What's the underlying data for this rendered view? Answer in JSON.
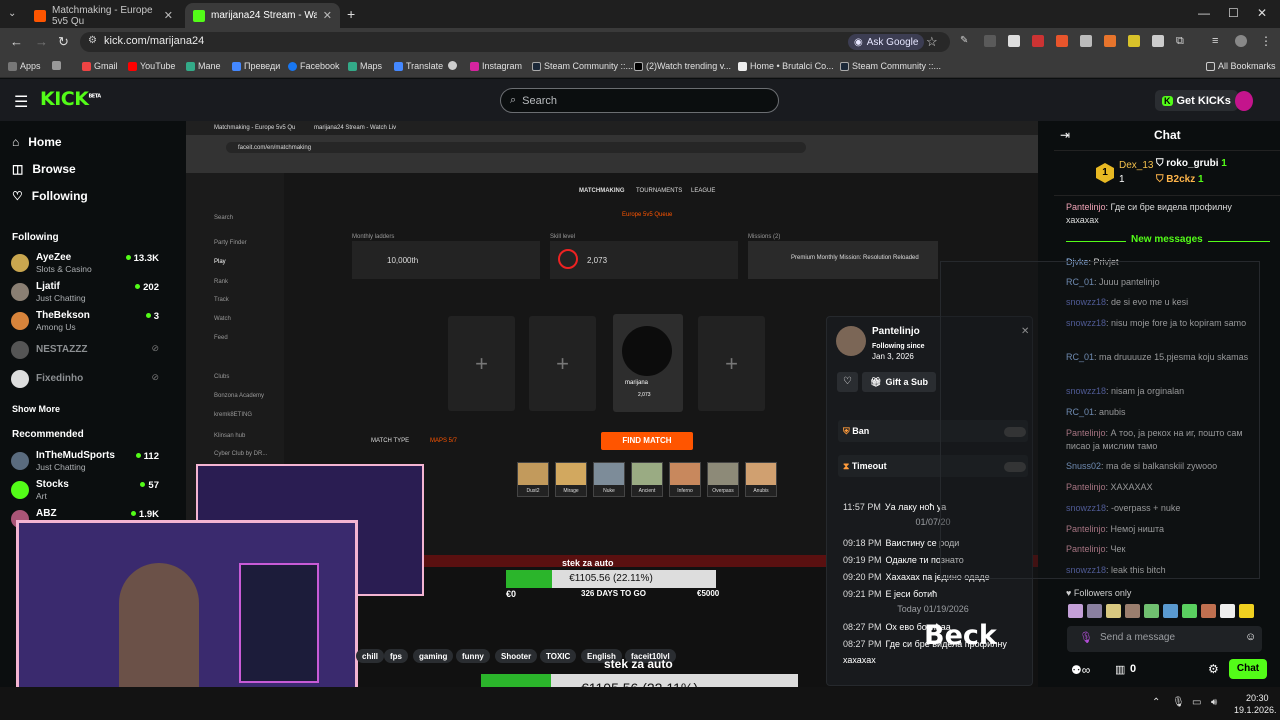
{
  "browser": {
    "tabs": [
      {
        "title": "Matchmaking - Europe 5v5 Qu",
        "active": false
      },
      {
        "title": "marijana24 Stream - Watch Liv",
        "active": true
      }
    ],
    "url": "kick.com/marijana24",
    "ask_google": "Ask Google",
    "bookmarks": [
      "Apps",
      "Gmail",
      "YouTube",
      "Mane",
      "Преведи",
      "Facebook",
      "Maps",
      "Translate",
      "Instagram",
      "Steam Community ::...",
      "(2)Watch trending v...",
      "Home • Brutalci Co...",
      "Steam Community ::..."
    ],
    "all_bookmarks": "All Bookmarks"
  },
  "kick": {
    "logo": "KICK",
    "logo_sup": "BETA",
    "search_placeholder": "Search",
    "get_kicks": "Get KICKs",
    "nav": [
      "Home",
      "Browse",
      "Following"
    ],
    "following_title": "Following",
    "following": [
      {
        "name": "AyeZee",
        "category": "Slots & Casino",
        "viewers": "13.3K",
        "color": "#c9a64f"
      },
      {
        "name": "Ljatif",
        "category": "Just Chatting",
        "viewers": "202",
        "color": "#8a7f73"
      },
      {
        "name": "TheBekson",
        "category": "Among Us",
        "viewers": "3",
        "color": "#d8843b"
      },
      {
        "name": "NESTAZZZ",
        "category": "",
        "viewers": "",
        "color": "#555"
      },
      {
        "name": "Fixedinho",
        "category": "",
        "viewers": "",
        "color": "#ddd"
      }
    ],
    "show_more": "Show More",
    "recommended_title": "Recommended",
    "recommended": [
      {
        "name": "InTheMudSports",
        "category": "Just Chatting",
        "viewers": "112",
        "color": "#5a6b7e"
      },
      {
        "name": "Stocks",
        "category": "Art",
        "viewers": "57",
        "color": "#53fc18"
      },
      {
        "name": "ABZ",
        "category": "",
        "viewers": "1.9K",
        "color": "#a57"
      }
    ]
  },
  "overlay": {
    "stek_label": "stek za auto",
    "goal_amount": "€1105.56 (22.11%)",
    "goal_progress": 0.2211,
    "start": "€0",
    "days": "326 DAYS TO GO",
    "end": "€5000",
    "watermark": "Beck"
  },
  "inner": {
    "tabs": [
      "Matchmaking - Europe 5v5 Qu",
      "marijana24 Stream - Watch Liv"
    ],
    "url": "faceit.com/en/matchmaking",
    "nav_tabs": [
      "MATCHMAKING",
      "TOURNAMENTS",
      "LEAGUE"
    ],
    "queue_label": "Europe 5v5 Queue",
    "menu": [
      "Search",
      "Party Finder",
      "Play",
      "Rank",
      "Track",
      "Watch",
      "Feed",
      "Clubs",
      "Bonzona Academy",
      "kremk8ETING",
      "Klinsan hub",
      "Cyber Club by DR..."
    ],
    "cards": [
      {
        "label": "Monthly ladders",
        "value": "10,000th"
      },
      {
        "label": "Skill level",
        "value": "2,073"
      },
      {
        "label": "Missions (2)",
        "value": "Premium Monthly Mission: Resolution Reloaded"
      }
    ],
    "player_name": "marijana",
    "player_elo": "2,073",
    "match_type": "MATCH TYPE",
    "maps": "MAPS 5/7",
    "find_match": "FIND MATCH",
    "map_names": [
      "Dust2",
      "Mirage",
      "Nuke",
      "Ancient",
      "Inferno",
      "Overpass",
      "Anubis"
    ]
  },
  "popup": {
    "name": "Pantelinjo",
    "following_since_label": "Following since",
    "following_since": "Jan 3, 2026",
    "gift_sub": "Gift a Sub",
    "ban": "Ban",
    "timeout": "Timeout",
    "history": [
      {
        "t": "11:57 PM",
        "m": "Уа лаку ноћ уа"
      },
      {
        "sep": "01/07/20"
      },
      {
        "t": "09:18 PM",
        "m": "Ваистину се роди"
      },
      {
        "t": "09:19 PM",
        "m": "Одакле ти познато"
      },
      {
        "t": "09:20 PM",
        "m": "Хахахах па једино одаде"
      },
      {
        "t": "09:21 PM",
        "m": "Е јеси ботић"
      },
      {
        "sep": "Today 01/19/2026"
      },
      {
        "t": "08:27 PM",
        "m": "Ох ево ботићаа"
      },
      {
        "t": "08:27 PM",
        "m": "Где си бре видела профилну"
      },
      {
        "t": "",
        "m": "хахахах"
      }
    ]
  },
  "tags": [
    "chill",
    "fps",
    "gaming",
    "funny",
    "Shooter",
    "TOXIC",
    "English",
    "faceit10lvl"
  ],
  "chat": {
    "title": "Chat",
    "leaders": [
      {
        "rank": "1",
        "name": "Dex_13",
        "count": "1"
      },
      {
        "name": "roko_grubi",
        "count": "1"
      },
      {
        "name": "B2ckz",
        "count": "1"
      }
    ],
    "pinned_user": "Pantelinjo",
    "pinned_msg": "Где си бре видела профилну хахахах",
    "new_messages": "New messages",
    "messages": [
      {
        "user": "Djvke",
        "text": "Privjet",
        "color": "#9ec7ff"
      },
      {
        "user": "RC_01",
        "text": "Juuu pantelinjo",
        "color": "#9ec7ff"
      },
      {
        "user": "snowzz18",
        "text": "de si evo me u kesi",
        "color": "#6f7fd6"
      },
      {
        "user": "snowzz18",
        "text": "nisu moje fore ja to kopiram samo",
        "color": "#6f7fd6"
      },
      {
        "user": "RC_01",
        "text": "ma druuuuze 15.pjesma koju skamas",
        "color": "#9ec7ff"
      },
      {
        "user": "snowzz18",
        "text": "nisam ja orginalan",
        "color": "#6f7fd6"
      },
      {
        "user": "RC_01",
        "text": "anubis",
        "color": "#9ec7ff"
      },
      {
        "user": "Pantelinjo",
        "text": "А тоо, ја рекох на иг, пошто сам писао ја мислим тамо",
        "color": "#f0a3b6"
      },
      {
        "user": "Snuss02",
        "text": "ma de si balkanskiil zywooo",
        "color": "#9ec7ff"
      },
      {
        "user": "Pantelinjo",
        "text": "XAXAXAX",
        "color": "#f0a3b6"
      },
      {
        "user": "snowzz18",
        "text": "-overpass + nuke",
        "color": "#6f7fd6"
      },
      {
        "user": "Pantelinjo",
        "text": "Немој ништа",
        "color": "#f0a3b6"
      },
      {
        "user": "Pantelinjo",
        "text": "Чек",
        "color": "#f0a3b6"
      },
      {
        "user": "snowzz18",
        "text": "leak this bitch",
        "color": "#6f7fd6"
      }
    ],
    "followers_only": "Followers only",
    "send_placeholder": "Send a message",
    "chat_button": "Chat",
    "points": "0"
  },
  "taskbar": {
    "time": "20:30",
    "date": "19.1.2026."
  }
}
